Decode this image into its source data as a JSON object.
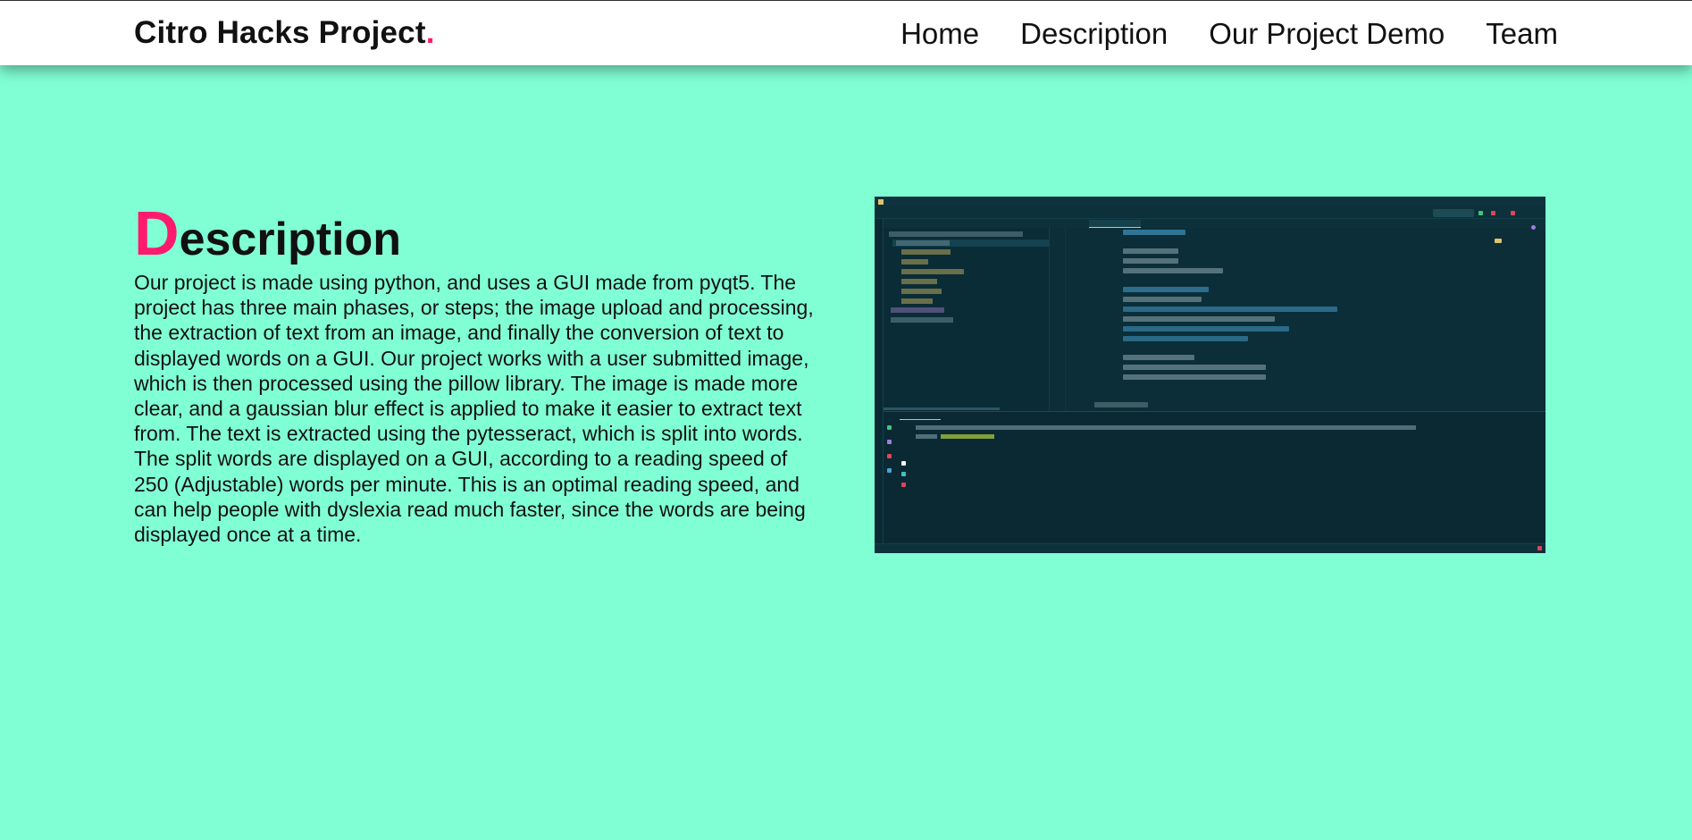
{
  "nav": {
    "brand": "Citro Hacks Project",
    "brand_dot": ".",
    "links": [
      "Home",
      "Description",
      "Our Project Demo",
      "Team"
    ]
  },
  "section": {
    "title_initial": "D",
    "title_rest": "escription",
    "body": "Our project is made using python, and uses a GUI made from pyqt5. The project has three main phases, or steps; the image upload and processing, the extraction of text from an image, and finally the conversion of text to displayed words on a GUI. Our project works with a user submitted image, which is then processed using the pillow library. The image is made more clear, and a gaussian blur effect is applied to make it easier to extract text from. The text is extracted using the pytesseract, which is split into words. The split words are displayed on a GUI, according to a reading speed of 250 (Adjustable) words per minute. This is an optimal reading speed, and can help people with dyslexia read much faster, since the words are being displayed once at a time."
  },
  "colors": {
    "background": "#80ffd4",
    "accent": "#ff1a6e",
    "navbar": "#ffffff",
    "ide_background": "#0b2e38"
  }
}
